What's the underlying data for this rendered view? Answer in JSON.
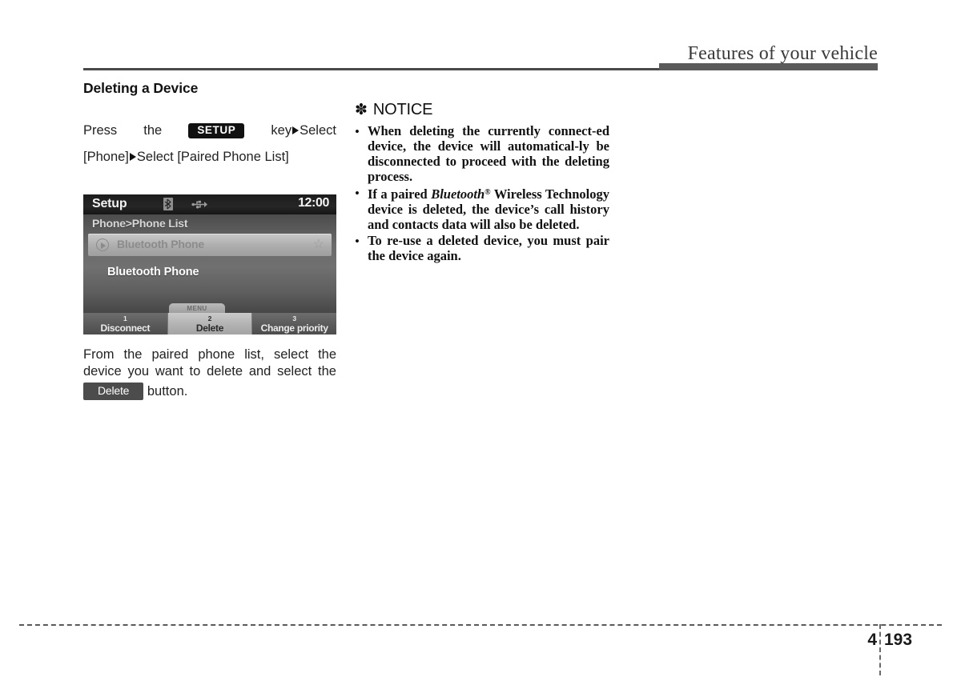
{
  "header": {
    "title": "Features of your vehicle"
  },
  "left": {
    "section_heading": "Deleting a Device",
    "instruction": {
      "word_press": "Press",
      "word_the": "the",
      "key_badge": "SETUP",
      "word_key": "key",
      "word_select": "Select",
      "line2": "[Phone]",
      "line2_rest_a": "Select [Paired Phone List]",
      "arrow_icon": "right-triangle-icon"
    },
    "device_screen": {
      "title": "Setup",
      "clock": "12:00",
      "status_icons": [
        "bluetooth-icon",
        "usb-icon"
      ],
      "breadcrumb": "Phone>Phone List",
      "list_row": {
        "label": "Bluetooth Phone",
        "leading_icon": "play-circle-icon",
        "trailing_icon": "star-icon"
      },
      "selected_device": "Bluetooth Phone",
      "menu_tab": "MENU",
      "softkeys": [
        {
          "number": "1",
          "label": "Disconnect",
          "active": false
        },
        {
          "number": "2",
          "label": "Delete",
          "active": true
        },
        {
          "number": "3",
          "label": "Change priority",
          "active": false
        }
      ]
    },
    "below_paragraph": {
      "line1_words": [
        "From",
        "the",
        "paired",
        "phone",
        "list,",
        "select",
        "the"
      ],
      "line2_words": [
        "device",
        "you",
        "want",
        "to",
        "delete",
        "and",
        "select",
        "the"
      ],
      "badge": "Delete",
      "line3_tail": "button."
    }
  },
  "right": {
    "notice_symbol": "✽",
    "notice_title": "NOTICE",
    "bullets": [
      {
        "bullet": "•",
        "html": "When deleting the currently connect-­ed device, the device will automatical-­ly be disconnected to proceed with the deleting process."
      },
      {
        "bullet": "•",
        "html": "If a paired <span class=\"bt\">Bluetooth</span><span class=\"reg\">®</span> Wireless Technology device is deleted, the device’s call history and contacts data will also be deleted."
      },
      {
        "bullet": "•",
        "html": "To re-use a deleted device, you must pair the device again."
      }
    ]
  },
  "footer": {
    "chapter": "4",
    "page_number": "193"
  }
}
